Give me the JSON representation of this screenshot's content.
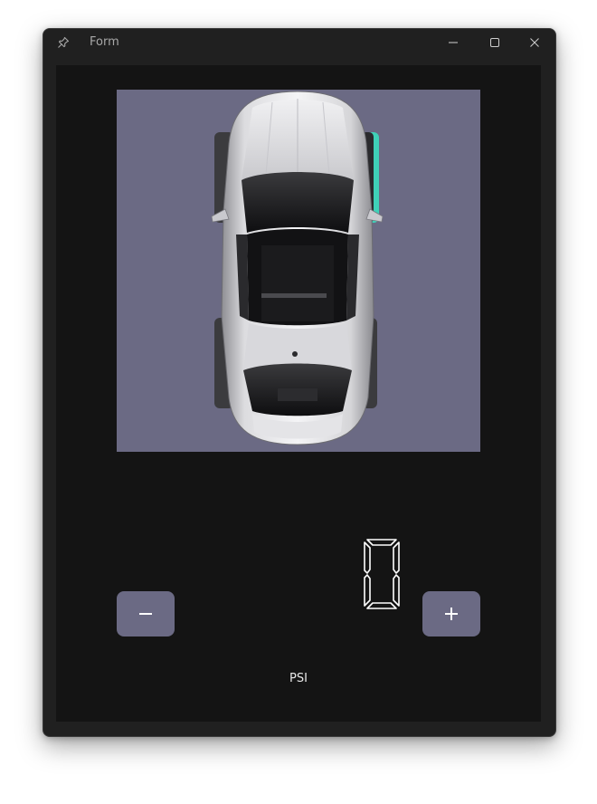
{
  "window": {
    "title": "Form",
    "buttons": [
      "minimize-icon",
      "maximize-icon",
      "close-icon"
    ]
  },
  "car_view": {
    "image": "car-top-view",
    "background": "#6b6a84",
    "selected_tire": "front-right",
    "tire_highlight_color": "#3fd1b8"
  },
  "pressure": {
    "value": "0",
    "unit": "PSI",
    "decrement_icon": "minus-icon",
    "increment_icon": "plus-icon"
  },
  "colors": {
    "client_bg": "#141414",
    "titlebar_bg": "#202020",
    "button_bg": "#6b6a84",
    "text": "#e8e8e8"
  }
}
